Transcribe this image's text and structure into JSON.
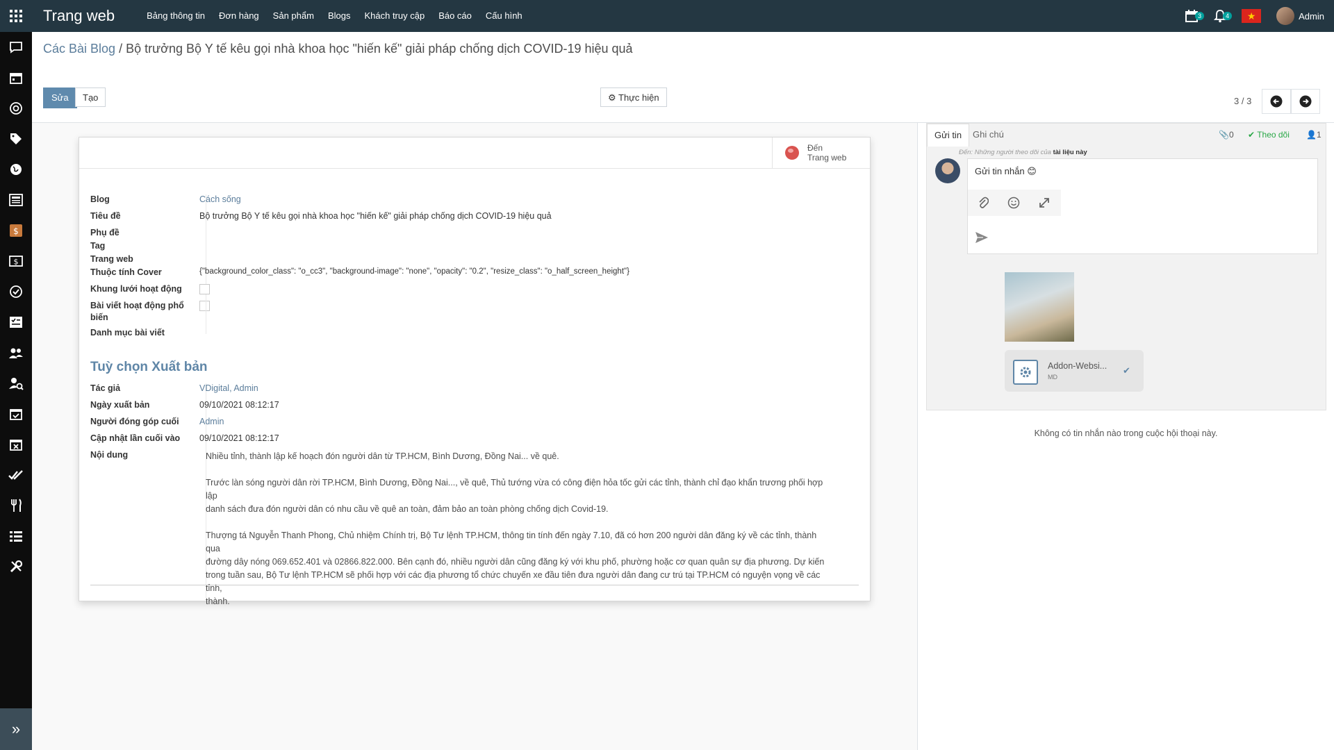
{
  "topbar": {
    "brand": "Trang web",
    "menu": [
      "Bảng thông tin",
      "Đơn hàng",
      "Sản phẩm",
      "Blogs",
      "Khách truy cập",
      "Báo cáo",
      "Cấu hình"
    ],
    "calendar_badge": "3",
    "notification_badge": "4",
    "user_name": "Admin"
  },
  "breadcrumb": {
    "parent": "Các Bài Blog",
    "separator": "/",
    "current": "Bộ trưởng Bộ Y tế kêu gọi nhà khoa học \"hiến kế\" giải pháp chống dịch COVID-19 hiệu quả"
  },
  "buttons": {
    "edit": "Sửa",
    "create": "Tạo",
    "action": "Thực hiện"
  },
  "pager": {
    "value": "3 / 3"
  },
  "stat_button": {
    "line1": "Đến",
    "line2": "Trang web"
  },
  "fields": {
    "blog_label": "Blog",
    "blog_value": "Cách sống",
    "title_label": "Tiêu đề",
    "title_value": "Bộ trưởng Bộ Y tế kêu gọi nhà khoa học \"hiến kế\" giải pháp chống dịch COVID-19 hiệu quả",
    "subtitle_label": "Phụ đề",
    "tag_label": "Tag",
    "website_label": "Trang web",
    "cover_label": "Thuộc tính Cover",
    "cover_value": "{\"background_color_class\": \"o_cc3\", \"background-image\": \"none\", \"opacity\": \"0.2\", \"resize_class\": \"o_half_screen_height\"}",
    "grid_label": "Khung lưới hoạt động",
    "popular_label_1": "Bài viết hoạt động phổ",
    "popular_label_2": "biến",
    "category_label": "Danh mục bài viết"
  },
  "publish": {
    "section_title": "Tuỳ chọn Xuất bản",
    "author_label": "Tác giả",
    "author_value": "VDigital, Admin",
    "date_label": "Ngày xuất bản",
    "date_value": "09/10/2021 08:12:17",
    "contributor_label": "Người đóng góp cuối",
    "contributor_value": "Admin",
    "updated_label": "Cập nhật lần cuối vào",
    "updated_value": "09/10/2021 08:12:17",
    "content_label": "Nội dung",
    "content_p1": "Nhiều tỉnh, thành lập kế hoạch đón người dân từ TP.HCM, Bình Dương, Đồng Nai... về quê.",
    "content_p2_l1": "Trước làn sóng người dân rời TP.HCM, Bình Dương, Đồng Nai..., về quê, Thủ tướng vừa có công điện hỏa tốc gửi các tỉnh, thành chỉ đạo khẩn trương phối hợp lập",
    "content_p2_l2": "danh sách đưa đón người dân có nhu cầu về quê an toàn, đảm bảo an toàn phòng chống dịch Covid-19.",
    "content_p3_l1": "Thượng tá Nguyễn Thanh Phong, Chủ nhiệm Chính trị, Bộ Tư lệnh TP.HCM, thông tin tính đến ngày 7.10, đã có hơn 200 người dân đăng ký về các tỉnh, thành qua",
    "content_p3_l2": "đường dây nóng 069.652.401 và 02866.822.000. Bên cạnh đó, nhiều người dân cũng đăng ký với khu phố, phường hoặc cơ quan quân sự địa phương. Dự kiến",
    "content_p3_l3": "trong tuần sau, Bộ Tư lệnh TP.HCM sẽ phối hợp với các địa phương tổ chức chuyến xe đầu tiên đưa người dân đang cư trú tại TP.HCM có nguyện vọng về các tỉnh,",
    "content_p3_l4": "thành."
  },
  "chatter": {
    "tab_send": "Gửi tin",
    "tab_note": "Ghi chú",
    "attachments_count": "0",
    "follow": "Theo dõi",
    "followers_count": "1",
    "to_prefix": "Đến:",
    "to_mid": "Những người theo dõi của",
    "to_doc": "tài liệu này",
    "composer_text": "Gửi tin nhắn 😊",
    "file_name": "Addon-Websi...",
    "file_ext": "MD",
    "empty": "Không có tin nhắn nào trong cuộc hội thoại này."
  }
}
